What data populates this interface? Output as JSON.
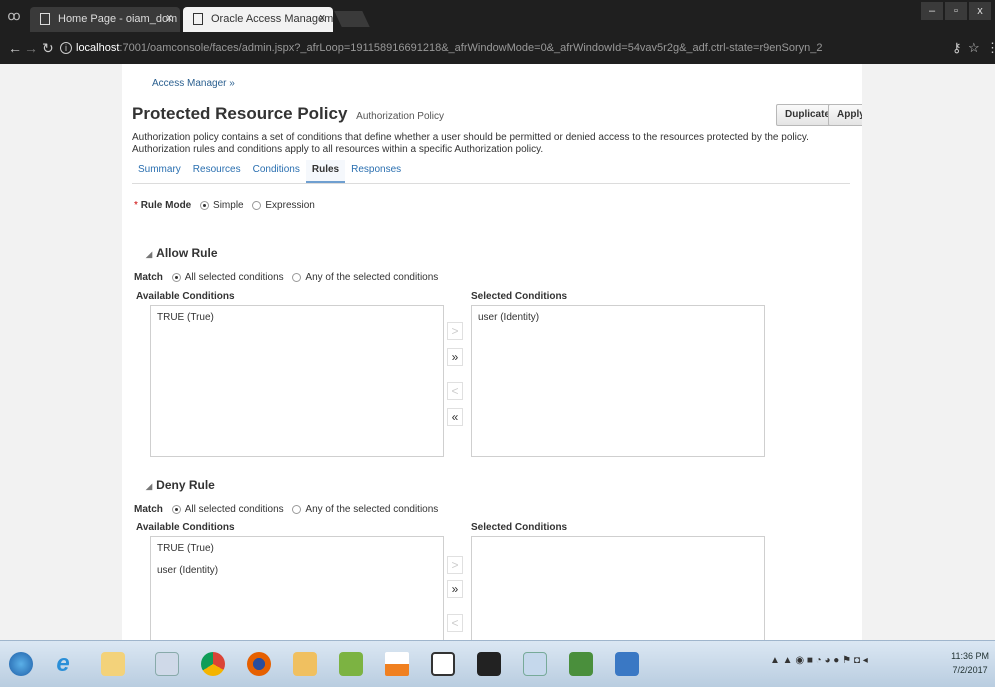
{
  "browser": {
    "incognito_icon": "incognito-icon",
    "tabs": [
      {
        "label": "Home Page - oiam_dom"
      },
      {
        "label": "Oracle Access Managem"
      }
    ],
    "tab_close": "x",
    "window_controls": [
      "–",
      "▫",
      "x"
    ],
    "url_host": "localhost",
    "url_rest": ":7001/oamconsole/faces/admin.jspx?_afrLoop=191158916691218&_afrWindowMode=0&_afrWindowId=54vav5r2g&_adf.ctrl-state=r9enSoryn_2"
  },
  "page": {
    "breadcrumb": "Access Manager »",
    "title": "Protected Resource Policy",
    "subtitle": "Authorization Policy",
    "duplicate_label": "Duplicate",
    "apply_label": "Apply",
    "description": "Authorization policy contains a set of conditions that define whether a user should be permitted or denied access to the resources protected by the policy. Authorization rules and conditions apply to all resources within a specific Authorization policy.",
    "tabs": [
      {
        "label": "Summary",
        "active": false
      },
      {
        "label": "Resources",
        "active": false
      },
      {
        "label": "Conditions",
        "active": false
      },
      {
        "label": "Rules",
        "active": true
      },
      {
        "label": "Responses",
        "active": false
      }
    ],
    "rule_mode": {
      "required_mark": "*",
      "label": "Rule Mode",
      "options": [
        {
          "label": "Simple",
          "selected": true
        },
        {
          "label": "Expression",
          "selected": false
        }
      ]
    },
    "allow_rule": {
      "title": "Allow Rule",
      "match_label": "Match",
      "match_options": [
        {
          "label": "All selected conditions",
          "selected": true
        },
        {
          "label": "Any of the selected conditions",
          "selected": false
        }
      ],
      "available_label": "Available Conditions",
      "selected_label": "Selected Conditions",
      "available": [
        "TRUE (True)"
      ],
      "selected": [
        "user (Identity)"
      ]
    },
    "deny_rule": {
      "title": "Deny Rule",
      "match_label": "Match",
      "match_options": [
        {
          "label": "All selected conditions",
          "selected": true
        },
        {
          "label": "Any of the selected conditions",
          "selected": false
        }
      ],
      "available_label": "Available Conditions",
      "selected_label": "Selected Conditions",
      "available": [
        "TRUE (True)",
        "user (Identity)"
      ],
      "selected": []
    },
    "shuttle": {
      "move": ">",
      "move_all": "»",
      "remove": "<",
      "remove_all": "«"
    }
  },
  "taskbar": {
    "apps": [
      "start-orb-icon",
      "internet-explorer-icon",
      "file-explorer-icon",
      "paint-icon",
      "chrome-icon",
      "firefox-icon",
      "outlook-icon",
      "project-icon",
      "vlc-icon",
      "document-icon",
      "terminal-icon",
      "snipping-tool-icon",
      "network-monitor-icon",
      "app-icon"
    ],
    "clock_time": "11:36 PM",
    "clock_date": "7/2/2017"
  }
}
